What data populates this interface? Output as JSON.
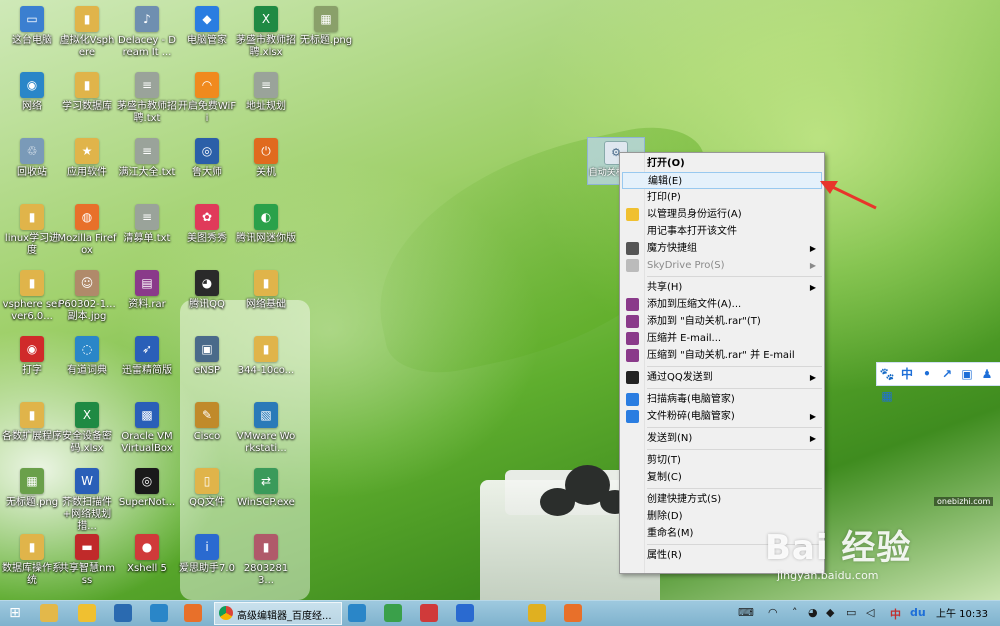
{
  "desktop_icons": [
    {
      "label": "这台电脑",
      "color": "#3b7fd0",
      "glyph": "▭"
    },
    {
      "label": "虚拟化Vsphere",
      "color": "#e0b44a",
      "glyph": "▮"
    },
    {
      "label": "Delacey - Dream It ...",
      "color": "#6f8fb0",
      "glyph": "♪"
    },
    {
      "label": "电脑管家",
      "color": "#2a7de1",
      "glyph": "◆"
    },
    {
      "label": "茅盛市教师招聘.xlsx",
      "color": "#1f8a43",
      "glyph": "X"
    },
    {
      "label": "无标题.png",
      "color": "#8aa06a",
      "glyph": "▦"
    },
    {
      "label": "网络",
      "color": "#2a86c8",
      "glyph": "◉"
    },
    {
      "label": "学习数据库",
      "color": "#e0b44a",
      "glyph": "▮"
    },
    {
      "label": "茅盛市教师招聘.txt",
      "color": "#9aa39a",
      "glyph": "≡"
    },
    {
      "label": "开启免费WiFi",
      "color": "#f08a1e",
      "glyph": "◠"
    },
    {
      "label": "地址规划",
      "color": "#9aa39a",
      "glyph": "≡"
    },
    {
      "label": "回收站",
      "color": "#7a9ab8",
      "glyph": "♲"
    },
    {
      "label": "应用软件",
      "color": "#e0b44a",
      "glyph": "★"
    },
    {
      "label": "满江大全.txt",
      "color": "#9aa39a",
      "glyph": "≡"
    },
    {
      "label": "鲁大师",
      "color": "#2b5fa8",
      "glyph": "◎"
    },
    {
      "label": "关机",
      "color": "#e06a1e",
      "glyph": "⏻"
    },
    {
      "label": "linux学习进度",
      "color": "#e0b44a",
      "glyph": "▮"
    },
    {
      "label": "Mozilla Firefox",
      "color": "#e8702a",
      "glyph": "◍"
    },
    {
      "label": "清募单.txt",
      "color": "#9aa39a",
      "glyph": "≡"
    },
    {
      "label": "美图秀秀",
      "color": "#e03a5a",
      "glyph": "✿"
    },
    {
      "label": "腾讯网迷你版",
      "color": "#2aa14a",
      "glyph": "◐"
    },
    {
      "label": "vsphere server6.0...",
      "color": "#e0b44a",
      "glyph": "▮"
    },
    {
      "label": "P60302-1...副本.jpg",
      "color": "#b08a6a",
      "glyph": "☺"
    },
    {
      "label": "资料.rar",
      "color": "#8a3a8a",
      "glyph": "▤"
    },
    {
      "label": "腾讯QQ",
      "color": "#2a2a2a",
      "glyph": "◕"
    },
    {
      "label": "网络基础",
      "color": "#e0b44a",
      "glyph": "▮"
    },
    {
      "label": "打字",
      "color": "#d02a2a",
      "glyph": "◉"
    },
    {
      "label": "有道词典",
      "color": "#2a86c8",
      "glyph": "◌"
    },
    {
      "label": "迅雷精简版",
      "color": "#2a5fb8",
      "glyph": "➶"
    },
    {
      "label": "eNSP",
      "color": "#4a6a8a",
      "glyph": "▣"
    },
    {
      "label": "344-10co...",
      "color": "#e0b44a",
      "glyph": "▮"
    },
    {
      "label": "各数扩展程序",
      "color": "#e0b44a",
      "glyph": "▮"
    },
    {
      "label": "安全设备密码.xlsx",
      "color": "#1f8a43",
      "glyph": "X"
    },
    {
      "label": "Oracle VM VirtualBox",
      "color": "#2a5fb8",
      "glyph": "▩"
    },
    {
      "label": "Cisco",
      "color": "#c08a2a",
      "glyph": "✎"
    },
    {
      "label": "VMware Workstati...",
      "color": "#2a7ab8",
      "glyph": "▧"
    },
    {
      "label": "无标题.png",
      "color": "#6aa04a",
      "glyph": "▦"
    },
    {
      "label": "芥数扫描件+网络规划措...",
      "color": "#2a5fb8",
      "glyph": "W"
    },
    {
      "label": "SuperNot...",
      "color": "#1a1a1a",
      "glyph": "◎"
    },
    {
      "label": "QQ文件",
      "color": "#e0b44a",
      "glyph": "▯"
    },
    {
      "label": "WinSCP.exe",
      "color": "#3a9a5a",
      "glyph": "⇄"
    },
    {
      "label": "数据库操作系统",
      "color": "#e0b44a",
      "glyph": "▮"
    },
    {
      "label": "共享智慧nmss",
      "color": "#c02a2a",
      "glyph": "▬"
    },
    {
      "label": "Xshell 5",
      "color": "#d03a3a",
      "glyph": "●"
    },
    {
      "label": "爱思助手7.0",
      "color": "#2a6ad0",
      "glyph": "i"
    },
    {
      "label": "28032813...",
      "color": "#b05a6a",
      "glyph": "▮"
    }
  ],
  "selected_icon": {
    "label": "自动关机.vbs"
  },
  "context_menu": {
    "items": [
      {
        "label": "打开(O)",
        "bold": true
      },
      {
        "label": "编辑(E)",
        "selected": true
      },
      {
        "label": "打印(P)"
      },
      {
        "label": "以管理员身份运行(A)",
        "icon": "shield-icon"
      },
      {
        "label": "用记事本打开该文件"
      },
      {
        "label": "魔方快捷组",
        "icon": "grid-icon",
        "submenu": true
      },
      {
        "label": "SkyDrive Pro(S)",
        "icon": "cloud-icon",
        "submenu": true,
        "disabled": true
      },
      {
        "separator": true
      },
      {
        "label": "共享(H)",
        "submenu": true
      },
      {
        "label": "添加到压缩文件(A)...",
        "icon": "winrar-icon"
      },
      {
        "label": "添加到 \"自动关机.rar\"(T)",
        "icon": "winrar-icon"
      },
      {
        "label": "压缩并 E-mail...",
        "icon": "winrar-icon"
      },
      {
        "label": "压缩到 \"自动关机.rar\" 并 E-mail",
        "icon": "winrar-icon"
      },
      {
        "separator": true
      },
      {
        "label": "通过QQ发送到",
        "icon": "qq-icon",
        "submenu": true
      },
      {
        "separator": true
      },
      {
        "label": "扫描病毒(电脑管家)",
        "icon": "shield-blue-icon"
      },
      {
        "label": "文件粉碎(电脑管家)",
        "icon": "shield-blue-icon",
        "submenu": true
      },
      {
        "separator": true
      },
      {
        "label": "发送到(N)",
        "submenu": true
      },
      {
        "separator": true
      },
      {
        "label": "剪切(T)"
      },
      {
        "label": "复制(C)"
      },
      {
        "separator": true
      },
      {
        "label": "创建快捷方式(S)"
      },
      {
        "label": "删除(D)"
      },
      {
        "label": "重命名(M)"
      },
      {
        "separator": true
      },
      {
        "label": "属性(R)"
      }
    ]
  },
  "qq_toolbar": {
    "items": [
      "🐾",
      "中",
      "•",
      "↗",
      "▣",
      "♟",
      "▦"
    ]
  },
  "watermark": {
    "main": "Bai 经验",
    "sub": "jingyan.baidu.com",
    "corner": "onebizhi.com"
  },
  "taskbar": {
    "active_window_title": "高级编辑器_百度经...",
    "tray_text": "du",
    "lang": "中",
    "clock": "上午 10:33"
  },
  "colors": {
    "menu_selected_bg": "#e5f1fb",
    "menu_selected_border": "#99c9ef",
    "arrow": "#e8352b"
  }
}
